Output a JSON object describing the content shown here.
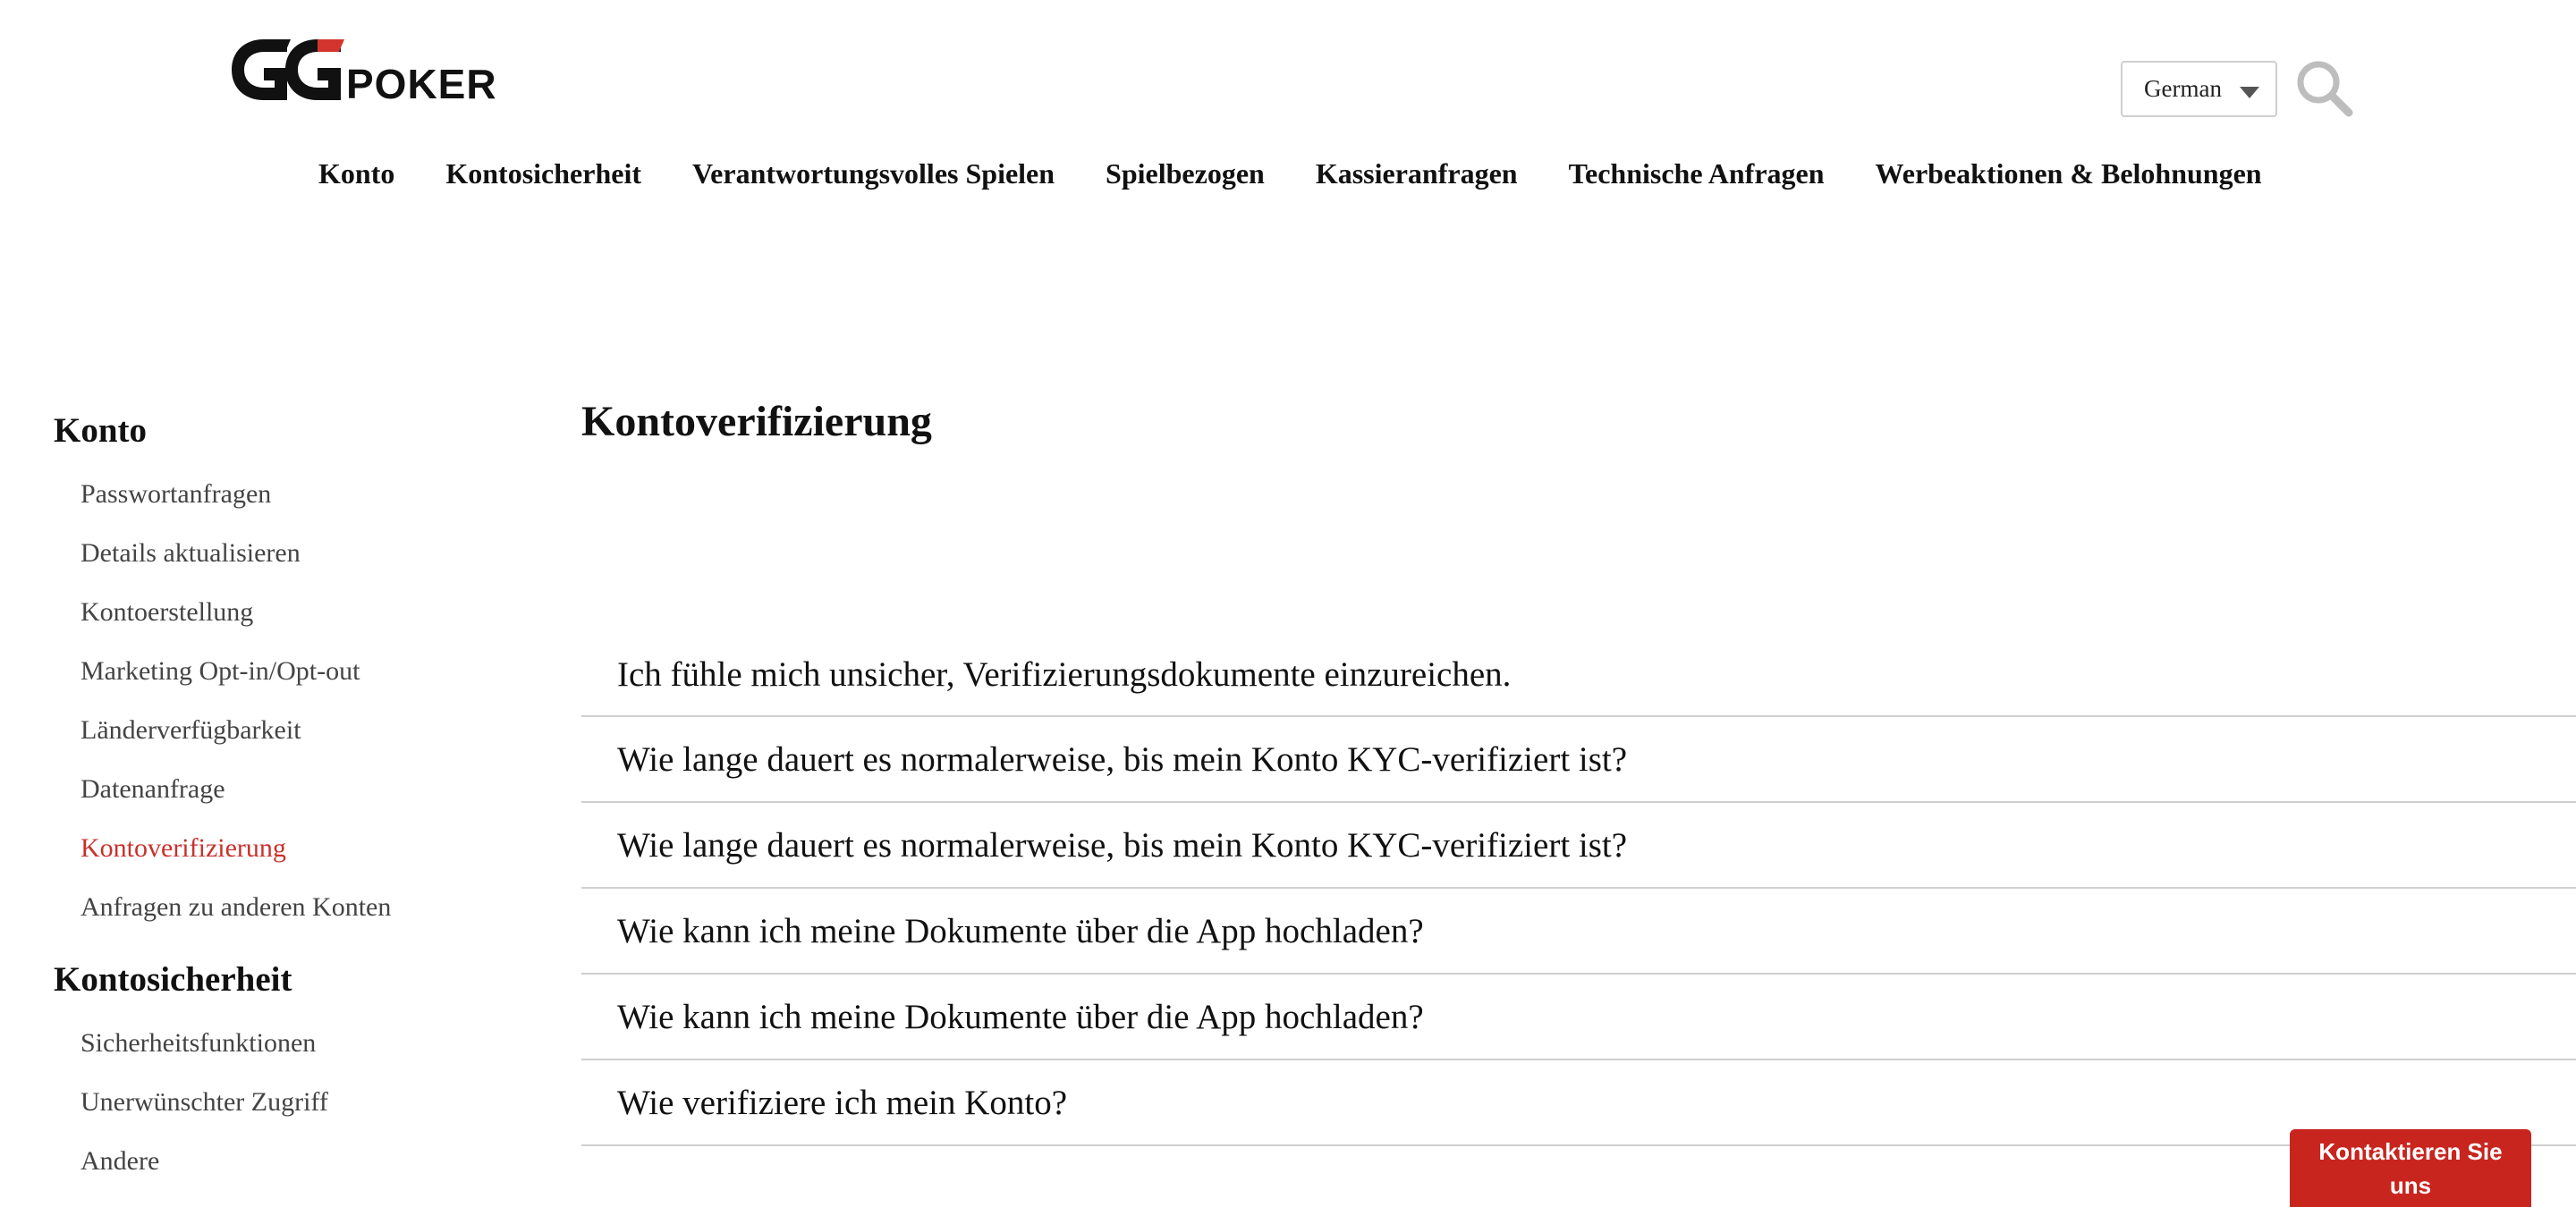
{
  "header": {
    "logo_text": "GGPOKER",
    "language": "German",
    "search_icon": "search-icon"
  },
  "nav": {
    "items": [
      "Konto",
      "Kontosicherheit",
      "Verantwortungsvolles Spielen",
      "Spielbezogen",
      "Kassieranfragen",
      "Technische Anfragen",
      "Werbeaktionen & Belohnungen"
    ]
  },
  "sidebar": {
    "groups": [
      {
        "title": "Konto",
        "items": [
          "Passwortanfragen",
          "Details aktualisieren",
          "Kontoerstellung",
          "Marketing Opt-in/Opt-out",
          "Länderverfügbarkeit",
          "Datenanfrage",
          "Kontoverifizierung",
          "Anfragen zu anderen Konten"
        ],
        "active_index": 6
      },
      {
        "title": "Kontosicherheit",
        "items": [
          "Sicherheitsfunktionen",
          "Unerwünschter Zugriff",
          "Andere"
        ]
      }
    ]
  },
  "main": {
    "title": "Kontoverifizierung",
    "faqs": [
      "Ich fühle mich unsicher, Verifizierungsdokumente einzureichen.",
      "Wie lange dauert es normalerweise, bis mein Konto KYC-verifiziert ist?",
      "Wie lange dauert es normalerweise, bis mein Konto KYC-verifiziert ist?",
      "Wie kann ich meine Dokumente über die App hochladen?",
      "Wie kann ich meine Dokumente über die App hochladen?",
      "Wie verifiziere ich mein Konto?"
    ]
  },
  "contact": {
    "label": "Kontaktieren Sie uns"
  },
  "colors": {
    "accent": "#c8312c",
    "contact_bg": "#c8251f",
    "divider": "#cfcfcf"
  }
}
